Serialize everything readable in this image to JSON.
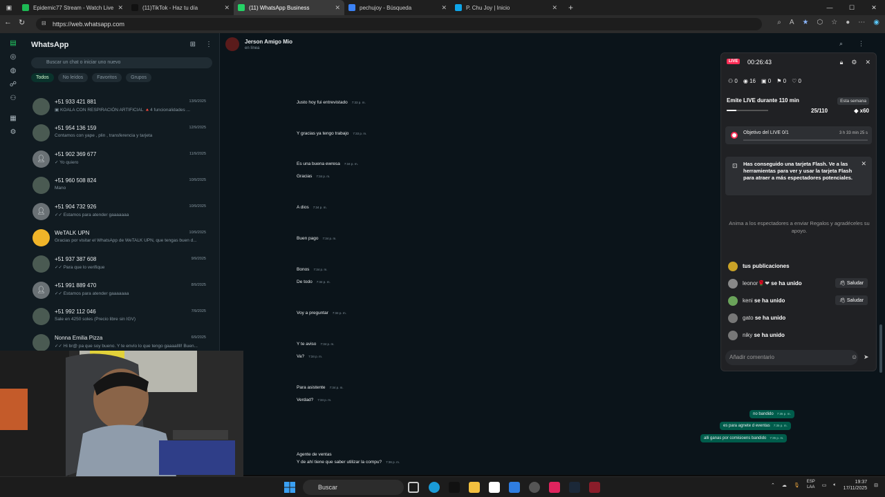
{
  "browser": {
    "tabs": [
      {
        "label": "Epidemic77 Stream - Watch Live",
        "color": "#1db954",
        "active": false
      },
      {
        "label": "(11)TikTok - Haz tu día",
        "color": "#111111",
        "active": false
      },
      {
        "label": "(11) WhatsApp Business",
        "color": "#25d366",
        "active": true
      },
      {
        "label": "pechujoy - Búsqueda",
        "color": "#3b82f6",
        "active": false
      },
      {
        "label": "P. Chu Joy | Inicio",
        "color": "#0ea5e9",
        "active": false
      }
    ],
    "url": "https://web.whatsapp.com"
  },
  "whatsapp": {
    "title": "WhatsApp",
    "search_placeholder": "Buscar un chat o iniciar uno nuevo",
    "filters": [
      "Todos",
      "No leídos",
      "Favoritos",
      "Grupos"
    ],
    "chats": [
      {
        "name": "+51 933 421 881",
        "preview": "▣ KOALA CON RESPIRACIÓN ARTIFICIAL 🔺4 funcionalidades ...",
        "date": "13/9/2025",
        "avatar": "img"
      },
      {
        "name": "+51 954 136 159",
        "preview": "Contamos con yape , plin , transferencia y tarjeta",
        "date": "12/9/2025",
        "avatar": "img"
      },
      {
        "name": "+51 902 369 677",
        "preview": "✓ Yo quiero",
        "date": "11/9/2025",
        "avatar": "person"
      },
      {
        "name": "+51 960 508 824",
        "preview": "Mano",
        "date": "10/9/2025",
        "avatar": "img"
      },
      {
        "name": "+51 904 732 926",
        "preview": "✓✓ Estamos para atender gaaaaaaa",
        "date": "10/9/2025",
        "avatar": "person"
      },
      {
        "name": "WeTALK UPN",
        "preview": "Gracias por visitar el WhatsApp de WeTALK UPN, que tengas buen d...",
        "date": "10/9/2025",
        "avatar": "brand"
      },
      {
        "name": "+51 937 387 608",
        "preview": "✓✓ Para que lo verifique",
        "date": "9/9/2025",
        "avatar": "img"
      },
      {
        "name": "+51 991 889 470",
        "preview": "✓✓ Estamos para atender gaaaaaaa",
        "date": "8/9/2025",
        "avatar": "person"
      },
      {
        "name": "+51 992 112 046",
        "preview": "Sale en 4250 soles (Precio libre sin IGV)",
        "date": "7/9/2025",
        "avatar": "img"
      },
      {
        "name": "Nonna Emilia Pizza",
        "preview": "✓✓ Hi br@ pa que soy bueno. Y te envío lo que tengo gaaaaIlll! Buen...",
        "date": "6/9/2025",
        "avatar": "img"
      }
    ],
    "contact": {
      "name": "Jerson Amigo Mio",
      "status": "en línea"
    },
    "messages_in": [
      {
        "text": "Justo hoy fui entrevistado",
        "time": "7:33 p. m."
      },
      {
        "text": "Y gracias ya tengo trabajo",
        "time": "7:33 p. m."
      },
      {
        "text": "Es una buena ewresa",
        "time": "7:34 p. m."
      },
      {
        "text": "Gracias",
        "time": "7:34 p. m."
      },
      {
        "text": "A dios",
        "time": "7:34 p. m."
      },
      {
        "text": "Buen pago",
        "time": "7:34 p. m."
      },
      {
        "text": "Bonos",
        "time": "7:34 p. m."
      },
      {
        "text": "De todo",
        "time": "7:34 p. m."
      },
      {
        "text": "Voy a preguntar",
        "time": "7:34 p. m."
      },
      {
        "text": "Y te aviso",
        "time": "7:34 p. m."
      },
      {
        "text": "Va?",
        "time": "7:34 p. m."
      },
      {
        "text": "Para asistente",
        "time": "7:34 p. m."
      },
      {
        "text": "Verdad?",
        "time": "7:34 p. m."
      },
      {
        "text": "Agente de ventas",
        "time": ""
      },
      {
        "text": "Y de ahí tiene que saber utilizar la compu?",
        "time": "7:36 p. m."
      }
    ],
    "messages_out": [
      {
        "text": "no bandido",
        "time": "7:35 p. m."
      },
      {
        "text": "es para agnete d eventas",
        "time": "7:35 p. m."
      },
      {
        "text": "alli ganas por comisioens bandido",
        "time": "7:35 p. m."
      }
    ]
  },
  "live": {
    "badge": "LIVE",
    "timer": "00:26:43",
    "stats": [
      "0",
      "16",
      "0",
      "0",
      "0"
    ],
    "goal_title": "Emite LIVE durante 110 min",
    "week": "Esta semana",
    "progress_text": "25/110",
    "progress_fraction": 0.227,
    "multiplier": "x60",
    "objective": "Objetivo del LIVE 0/1",
    "objective_time": "3 h 33 min 25 s",
    "flash_text": "Has conseguido una tarjeta Flash. Ve a las herramientas para ver y usar la tarjeta Flash para atraer a más espectadores potenciales.",
    "encourage": "Anima a los espectadores a enviar Regalos y agradéceles su apoyo.",
    "feed": [
      {
        "user": "",
        "text": "tus publicaciones",
        "button": ""
      },
      {
        "user": "leonor🌹❤",
        "text": "se ha unido",
        "button": "Saludar"
      },
      {
        "user": "keni",
        "text": "se ha unido",
        "button": "Saludar"
      },
      {
        "user": "gato",
        "text": "se ha unido",
        "button": ""
      },
      {
        "user": "niky",
        "text": "se ha unido",
        "button": ""
      }
    ],
    "comment_placeholder": "Añadir comentario"
  },
  "taskbar": {
    "search": "Buscar",
    "lang": "ESP",
    "lang2": "LAA",
    "time": "19:37",
    "date": "17/11/2025"
  }
}
